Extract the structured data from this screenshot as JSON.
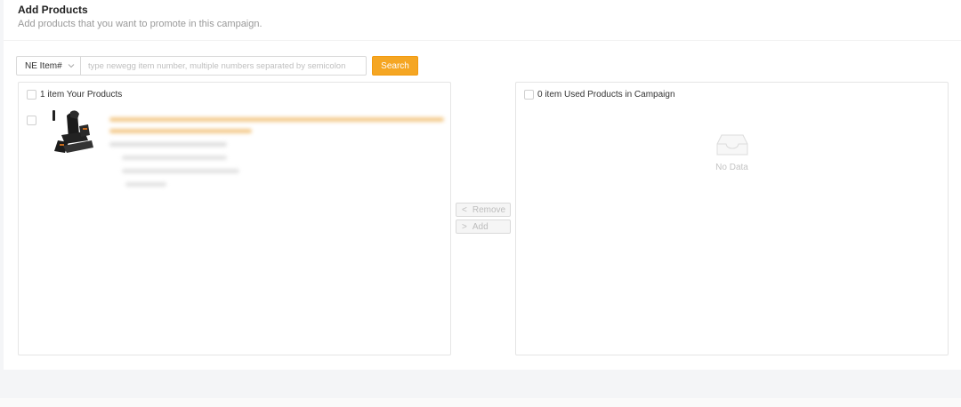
{
  "header": {
    "title": "Add Products",
    "subtitle": "Add products that you want to promote in this campaign."
  },
  "search": {
    "type_value": "NE Item#",
    "placeholder": "type newegg item number, multiple numbers separated by semicolon",
    "button_label": "Search"
  },
  "left_panel": {
    "header_label": "1 item Your Products",
    "items": [
      {
        "name": "product-massage-chair",
        "image_icon": "massage-chair-image",
        "details_blurred": true
      }
    ]
  },
  "right_panel": {
    "header_label": "0 item Used Products in Campaign",
    "empty_text": "No Data",
    "empty_icon": "inbox-icon"
  },
  "operations": {
    "remove_label": "Remove",
    "add_label": "Add"
  },
  "colors": {
    "accent": "#f5a623",
    "border": "#e5e5e5",
    "muted_text": "#999999"
  }
}
